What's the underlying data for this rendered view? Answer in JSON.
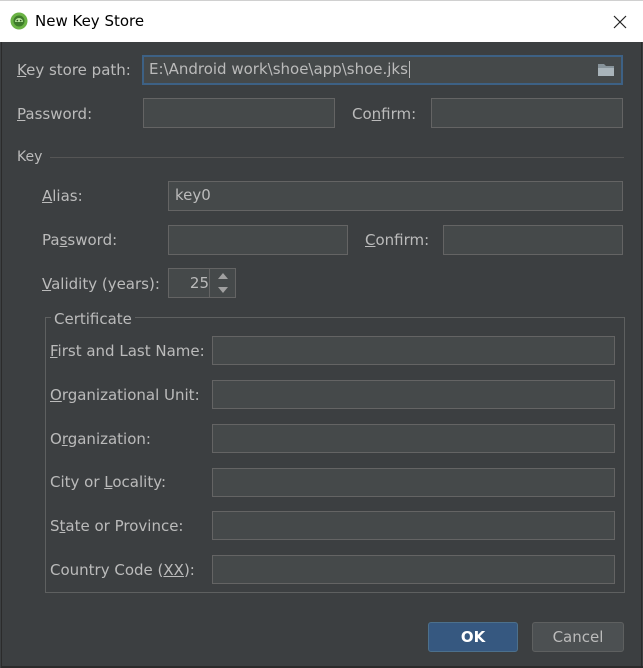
{
  "window": {
    "title": "New Key Store",
    "close_glyph": "✕"
  },
  "keystore": {
    "path_label_u": "K",
    "path_label_rest": "ey store path:",
    "path_value": "E:\\Android work\\shoe\\app\\shoe.jks",
    "password_label_u": "P",
    "password_label_rest": "assword:",
    "password_value": "",
    "confirm_label_pre": "Co",
    "confirm_label_u": "n",
    "confirm_label_rest": "firm:",
    "confirm_value": ""
  },
  "key": {
    "section_label": "Key",
    "alias_label_u": "A",
    "alias_label_rest": "lias:",
    "alias_value": "key0",
    "password_label_pre": "Pa",
    "password_label_u": "s",
    "password_label_rest": "sword:",
    "password_value": "",
    "confirm_label_u": "C",
    "confirm_label_rest": "onfirm:",
    "confirm_value": "",
    "validity_label_u": "V",
    "validity_label_rest": "alidity (years):",
    "validity_value": "25"
  },
  "certificate": {
    "title": "Certificate",
    "fields": [
      {
        "label_pre": "",
        "label_u": "F",
        "label_rest": "irst and Last Name:",
        "value": ""
      },
      {
        "label_pre": "",
        "label_u": "O",
        "label_rest": "rganizational Unit:",
        "value": ""
      },
      {
        "label_pre": "O",
        "label_u": "r",
        "label_rest": "ganization:",
        "value": ""
      },
      {
        "label_pre": "City or ",
        "label_u": "L",
        "label_rest": "ocality:",
        "value": ""
      },
      {
        "label_pre": "S",
        "label_u": "t",
        "label_rest": "ate or Province:",
        "value": ""
      },
      {
        "label_pre": "Country Code (",
        "label_u": "XX",
        "label_rest": "):",
        "value": ""
      }
    ]
  },
  "buttons": {
    "ok_label": "OK",
    "cancel_label": "Cancel"
  },
  "colors": {
    "background": "#3c3f41",
    "field_bg": "#45494a",
    "field_border": "#646464",
    "focus_border": "#3d6185",
    "text": "#bbbbbb",
    "ok_button": "#365880"
  },
  "icons": {
    "app": "android-studio-icon",
    "close": "close-icon",
    "browse": "folder-icon",
    "spinner_up": "spinner-up-icon",
    "spinner_down": "spinner-down-icon"
  }
}
